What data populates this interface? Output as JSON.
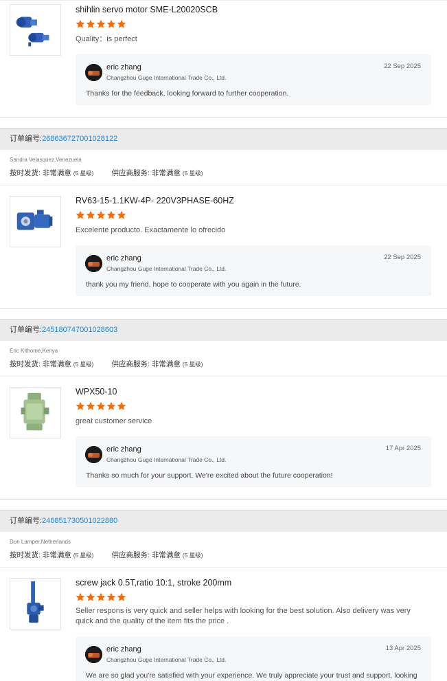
{
  "colors": {
    "star": "#ff6a00",
    "link": "#1f86d4",
    "order_bar": "#ebebeb",
    "reply_bg": "#f6f7f9"
  },
  "order_label": "订单编号:",
  "ratings_labels": {
    "on_time": "按时发货:",
    "service": "供应商服务:",
    "value": "非常满意",
    "level": "(5 星级)"
  },
  "reviews": [
    {
      "product": "shihlin servo motor SME-L20020SCB",
      "image_icon": "blue-servo-motor-image",
      "stars": 5,
      "text": "Quality：is perfect",
      "reply": {
        "name": "eric zhang",
        "company": "Changzhou Guge International Trade Co., Ltd.",
        "date": "22 Sep 2025",
        "text": "Thanks for the feedback, looking forward to further cooperation."
      }
    },
    {
      "order_no": "268636727001028122",
      "buyer": "Sandra Velasquez,Venezuela",
      "product": "RV63-15-1.1KW-4P- 220V3PHASE-60HZ",
      "image_icon": "worm-gearbox-motor-image",
      "stars": 5,
      "text": "Excelente producto. Exactamente lo ofrecido",
      "reply": {
        "name": "eric zhang",
        "company": "Changzhou Guge International Trade Co., Ltd.",
        "date": "22 Sep 2025",
        "text": "thank you my friend, hope to cooperate with you again in the future."
      }
    },
    {
      "order_no": "245180747001028603",
      "buyer": "Eric Kithome,Kenya",
      "product": "WPX50-10",
      "image_icon": "green-gear-reducer-image",
      "stars": 5,
      "text": "great customer service",
      "reply": {
        "name": "eric zhang",
        "company": "Changzhou Guge International Trade Co., Ltd.",
        "date": "17 Apr 2025",
        "text": "Thanks so much for your support. We're excited about the future cooperation!"
      }
    },
    {
      "order_no": "246851730501022880",
      "buyer": "Don Lamper,Netherlands",
      "product": "screw jack 0.5T,ratio 10:1, stroke 200mm",
      "image_icon": "blue-screw-jack-image",
      "stars": 5,
      "text": "Seller respons is very quick and seller helps with looking for the best solution. Also delivery was very quick and the quality of the item fits the price .",
      "reply": {
        "name": "eric zhang",
        "company": "Changzhou Guge International Trade Co., Ltd.",
        "date": "13 Apr 2025",
        "text": "We are so glad you're satisfied with your experience. We truly appreciate your trust and support, looking"
      }
    }
  ]
}
